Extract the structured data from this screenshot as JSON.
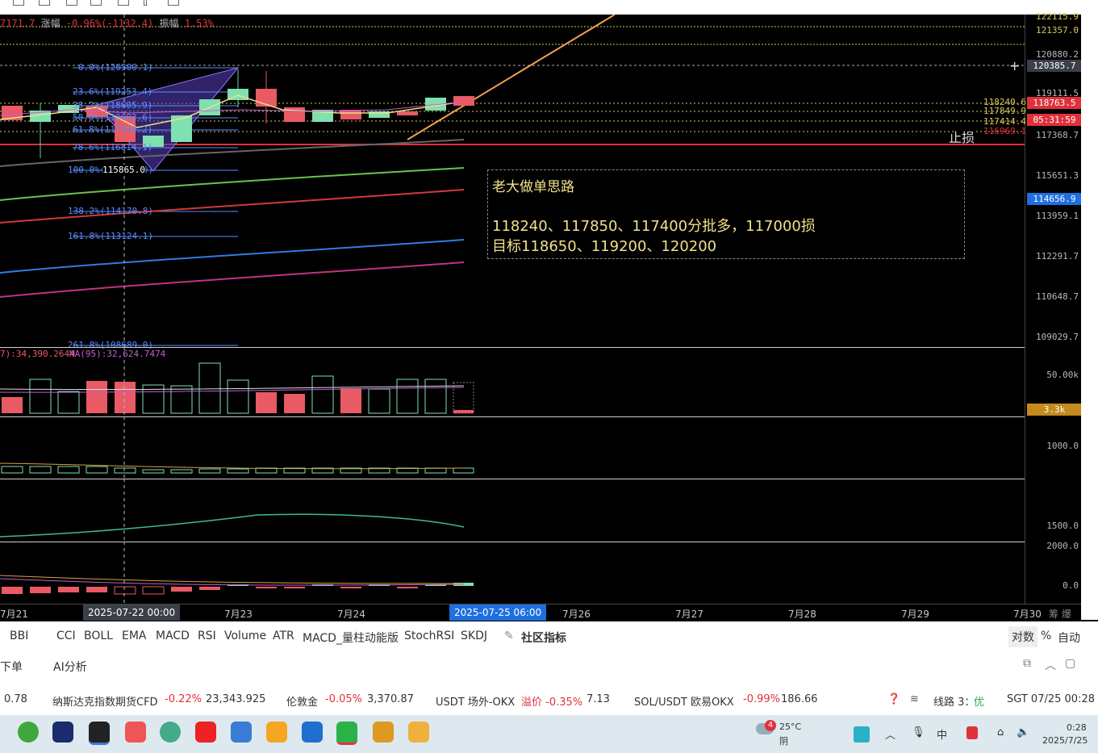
{
  "header_info": {
    "price_fragment": "7171.7",
    "change_label": "涨幅",
    "change_value": "-0.96%(-1132.4)",
    "amp_label": "振幅",
    "amp_value": "1.53%"
  },
  "fib_levels": [
    {
      "label": "0.0%(120300.1)",
      "price": 120300.1
    },
    {
      "label": "23.6%(119253.4)",
      "price": 119253.4
    },
    {
      "label": "38.2%(118605.9)",
      "price": 118605.9
    },
    {
      "label": "50.0%(118082.6)",
      "price": 118082.6
    },
    {
      "label": "61.8%(117559.2)",
      "price": 117559.2
    },
    {
      "label": "78.6%(116814.1)",
      "price": 116814.1
    },
    {
      "label": "100.0%(115865.0)",
      "price": 115865.0
    },
    {
      "label": "138.2%(114170.8)",
      "price": 114170.8
    },
    {
      "label": "161.8%(113124.1)",
      "price": 113124.1
    },
    {
      "label": "261.8%(108689.0)",
      "price": 108689.0
    }
  ],
  "low_marker": "115865.0",
  "stop_label": "止损",
  "note": {
    "title": "老大做单思路",
    "line1": "118240、117850、117400分批多，117000损",
    "line2": "目标118650、119200、120200"
  },
  "price_axis": {
    "ticks": [
      "121357.0",
      "120880.2",
      "119111.5",
      "117368.7",
      "115651.3",
      "113959.1",
      "112291.7",
      "110648.7",
      "109029.7"
    ],
    "top_partial": "122115.9",
    "tags": [
      {
        "text": "120385.7",
        "color": "#3a3f48"
      },
      {
        "text": "118240.6",
        "color": "#000000"
      },
      {
        "text": "117849.9",
        "color": "#000000"
      },
      {
        "text": "117414.4",
        "color": "#000000"
      },
      {
        "text": "116969.1",
        "color": "#000000"
      },
      {
        "text": "118763.5",
        "color": "#e0313b"
      },
      {
        "text": "05:31:59",
        "color": "#e0313b"
      },
      {
        "text": "114656.9",
        "color": "#1e6fe0"
      }
    ]
  },
  "volume": {
    "ma_label_1": "7):34,390.2644",
    "ma_label_2": "MA(95):32,624.7474",
    "tick": "50.00k",
    "current": "3.3k"
  },
  "sub_axes": {
    "p2": "1000.0",
    "p3": "1500.0",
    "p4_top": "2000.0",
    "p4": "0.0"
  },
  "x_axis": {
    "labels": [
      "7月21",
      "7月23",
      "7月24",
      "7月26",
      "7月27",
      "7月28",
      "7月29",
      "7月30"
    ],
    "crosshair_date": "2025-07-22 00:00",
    "current_date": "2025-07-25 06:00",
    "end_icons": "筹 爆"
  },
  "indicator_tabs": [
    "BBI",
    "CCI",
    "BOLL",
    "EMA",
    "MACD",
    "RSI",
    "Volume",
    "ATR",
    "MACD_量柱动能版",
    "StochRSI",
    "SKDJ",
    "社区指标"
  ],
  "tab_right": {
    "log": "对数",
    "pct": "%",
    "auto": "自动"
  },
  "sub_bar": {
    "left": "下单",
    "ai": "AI分析"
  },
  "ticker": [
    {
      "name": "0.78",
      "change": "",
      "value": ""
    },
    {
      "name": "纳斯达克指数期货CFD",
      "change": "-0.22%",
      "value": "23,343.925"
    },
    {
      "name": "伦敦金",
      "change": "-0.05%",
      "value": "3,370.87"
    },
    {
      "name": "USDT 场外-OKX",
      "change": "溢价 -0.35%",
      "value": "7.13"
    },
    {
      "name": "SOL/USDT 欧易OKX",
      "change": "-0.99%",
      "value": "186.66"
    }
  ],
  "status": {
    "line": "线路 3：",
    "quality": "优",
    "clock": "SGT 07/25 00:28"
  },
  "taskbar": {
    "weather_temp": "25°C",
    "weather_desc": "阴",
    "badge": "4",
    "time": "0:28",
    "date": "2025/7/25",
    "ime": "中"
  }
}
